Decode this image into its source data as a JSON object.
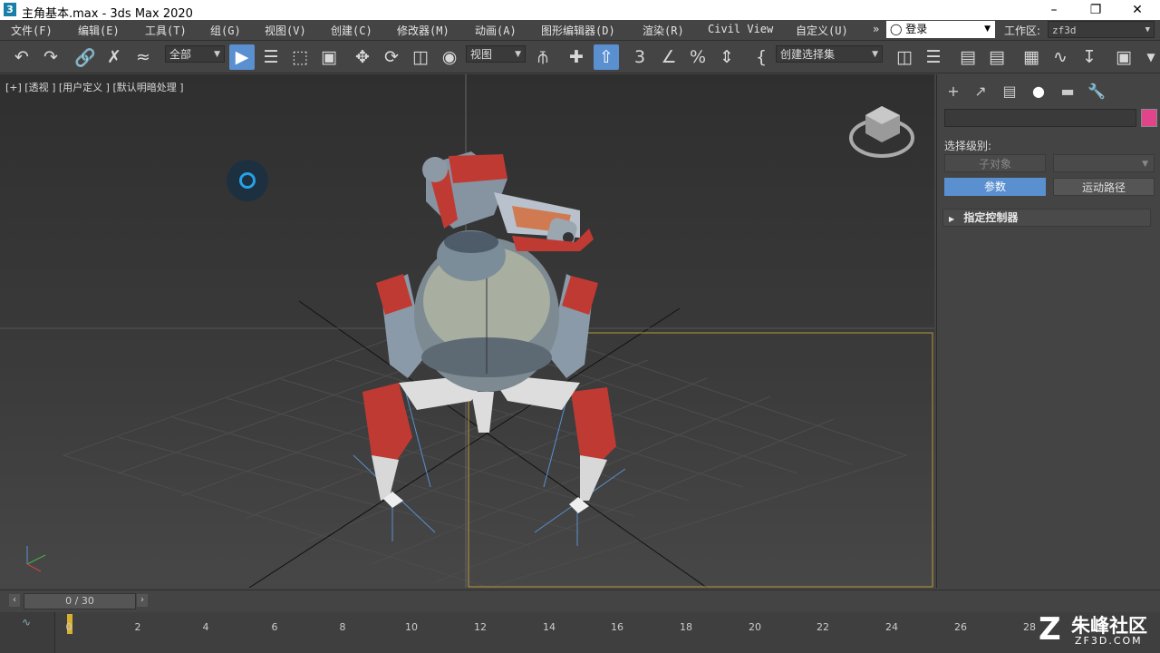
{
  "window": {
    "title": "主角基本.max - 3ds Max 2020",
    "app_icon": "3",
    "minimize": "–",
    "maximize": "❐",
    "close": "✕"
  },
  "menu": [
    {
      "label": "文件(F)"
    },
    {
      "label": "编辑(E)"
    },
    {
      "label": "工具(T)"
    },
    {
      "label": "组(G)"
    },
    {
      "label": "视图(V)"
    },
    {
      "label": "创建(C)"
    },
    {
      "label": "修改器(M)"
    },
    {
      "label": "动画(A)"
    },
    {
      "label": "图形编辑器(D)"
    },
    {
      "label": "渲染(R)"
    },
    {
      "label": "Civil View"
    },
    {
      "label": "自定义(U)"
    }
  ],
  "menu_overflow": "»",
  "login": {
    "icon": "user-icon",
    "label": "登录"
  },
  "workspace": {
    "label": "工作区:",
    "value": "zf3d"
  },
  "toolbar": {
    "filter_combo": "全部",
    "coord_combo": "视图",
    "selection_set_combo": "创建选择集"
  },
  "viewport": {
    "label": "[+] [透视 ] [用户定义 ] [默认明暗处理 ]"
  },
  "command_panel": {
    "selection_level_label": "选择级别:",
    "sub_object_button": "子对象",
    "params_button": "参数",
    "motion_path_button": "运动路径",
    "rollout_title": "指定控制器",
    "object_color": "#e0458c"
  },
  "timeline": {
    "frame_display": "0 / 30",
    "ticks": [
      "0",
      "2",
      "4",
      "6",
      "8",
      "10",
      "12",
      "14",
      "16",
      "18",
      "20",
      "22",
      "24",
      "26",
      "28"
    ]
  },
  "watermark": {
    "brand": "朱峰社区",
    "url": "ZF3D.COM"
  },
  "colors": {
    "accent": "#5a8fd0",
    "selection_box": "#b89a3a"
  }
}
